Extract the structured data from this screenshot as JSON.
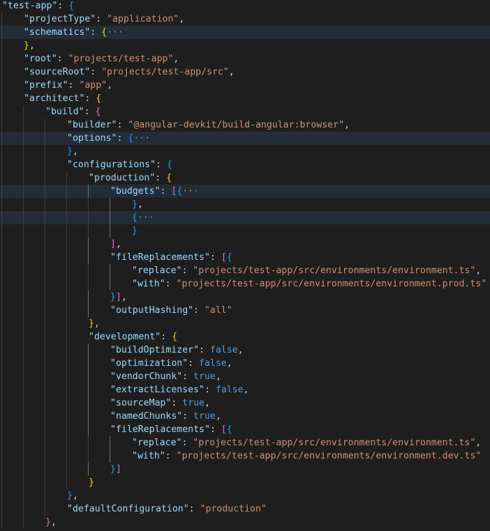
{
  "colors": {
    "background": "#1e1e1e",
    "line_highlight": "#232d38",
    "key": "#9cdcfe",
    "string": "#ce9178",
    "boolean": "#569cd6",
    "punctuation": "#d4d4d4",
    "bracket_gold": "#ffd700",
    "bracket_orchid": "#da70d6",
    "bracket_blue": "#179fff",
    "fold_ellipsis": "#8c8c8c"
  },
  "editor": {
    "lines": [
      {
        "indent": 0,
        "tokens": [
          {
            "t": "key",
            "v": "\"test-app\""
          },
          {
            "t": "p",
            "v": ": "
          },
          {
            "t": "b2",
            "v": "{"
          }
        ]
      },
      {
        "indent": 1,
        "tokens": [
          {
            "t": "key",
            "v": "\"projectType\""
          },
          {
            "t": "p",
            "v": ": "
          },
          {
            "t": "str",
            "v": "\"application\""
          },
          {
            "t": "p",
            "v": ","
          }
        ]
      },
      {
        "indent": 1,
        "highlight": true,
        "tokens": [
          {
            "t": "key",
            "v": "\"schematics\""
          },
          {
            "t": "p",
            "v": ": "
          },
          {
            "t": "b0",
            "v": "{"
          },
          {
            "t": "e",
            "v": "···"
          }
        ]
      },
      {
        "indent": 1,
        "tokens": [
          {
            "t": "b0",
            "v": "}"
          },
          {
            "t": "p",
            "v": ","
          }
        ]
      },
      {
        "indent": 1,
        "tokens": [
          {
            "t": "key",
            "v": "\"root\""
          },
          {
            "t": "p",
            "v": ": "
          },
          {
            "t": "str",
            "v": "\"projects/test-app\""
          },
          {
            "t": "p",
            "v": ","
          }
        ]
      },
      {
        "indent": 1,
        "tokens": [
          {
            "t": "key",
            "v": "\"sourceRoot\""
          },
          {
            "t": "p",
            "v": ": "
          },
          {
            "t": "str",
            "v": "\"projects/test-app/src\""
          },
          {
            "t": "p",
            "v": ","
          }
        ]
      },
      {
        "indent": 1,
        "tokens": [
          {
            "t": "key",
            "v": "\"prefix\""
          },
          {
            "t": "p",
            "v": ": "
          },
          {
            "t": "str",
            "v": "\"app\""
          },
          {
            "t": "p",
            "v": ","
          }
        ]
      },
      {
        "indent": 1,
        "tokens": [
          {
            "t": "key",
            "v": "\"architect\""
          },
          {
            "t": "p",
            "v": ": "
          },
          {
            "t": "b0",
            "v": "{"
          }
        ]
      },
      {
        "indent": 2,
        "tokens": [
          {
            "t": "key",
            "v": "\"build\""
          },
          {
            "t": "p",
            "v": ": "
          },
          {
            "t": "b1",
            "v": "{"
          }
        ]
      },
      {
        "indent": 3,
        "tokens": [
          {
            "t": "key",
            "v": "\"builder\""
          },
          {
            "t": "p",
            "v": ": "
          },
          {
            "t": "str",
            "v": "\"@angular-devkit/build-angular:browser\""
          },
          {
            "t": "p",
            "v": ","
          }
        ]
      },
      {
        "indent": 3,
        "highlight": true,
        "tokens": [
          {
            "t": "key",
            "v": "\"options\""
          },
          {
            "t": "p",
            "v": ": "
          },
          {
            "t": "b2",
            "v": "{"
          },
          {
            "t": "e",
            "v": "···"
          }
        ]
      },
      {
        "indent": 3,
        "tokens": [
          {
            "t": "b2",
            "v": "}"
          },
          {
            "t": "p",
            "v": ","
          }
        ]
      },
      {
        "indent": 3,
        "tokens": [
          {
            "t": "key",
            "v": "\"configurations\""
          },
          {
            "t": "p",
            "v": ": "
          },
          {
            "t": "b2",
            "v": "{"
          }
        ]
      },
      {
        "indent": 4,
        "tokens": [
          {
            "t": "key",
            "v": "\"production\""
          },
          {
            "t": "p",
            "v": ": "
          },
          {
            "t": "b0",
            "v": "{"
          }
        ]
      },
      {
        "indent": 5,
        "highlight": true,
        "tokens": [
          {
            "t": "key",
            "v": "\"budgets\""
          },
          {
            "t": "p",
            "v": ": "
          },
          {
            "t": "b1",
            "v": "["
          },
          {
            "t": "b2",
            "v": "{"
          },
          {
            "t": "e",
            "v": "···"
          }
        ]
      },
      {
        "indent": 6,
        "tokens": [
          {
            "t": "b2",
            "v": "}"
          },
          {
            "t": "p",
            "v": ","
          }
        ]
      },
      {
        "indent": 6,
        "highlight": true,
        "tokens": [
          {
            "t": "b2",
            "v": "{"
          },
          {
            "t": "e",
            "v": "···"
          }
        ]
      },
      {
        "indent": 6,
        "tokens": [
          {
            "t": "b2",
            "v": "}"
          }
        ]
      },
      {
        "indent": 5,
        "tokens": [
          {
            "t": "b1",
            "v": "]"
          },
          {
            "t": "p",
            "v": ","
          }
        ]
      },
      {
        "indent": 5,
        "tokens": [
          {
            "t": "key",
            "v": "\"fileReplacements\""
          },
          {
            "t": "p",
            "v": ": "
          },
          {
            "t": "b1",
            "v": "["
          },
          {
            "t": "b2",
            "v": "{"
          }
        ]
      },
      {
        "indent": 6,
        "tokens": [
          {
            "t": "key",
            "v": "\"replace\""
          },
          {
            "t": "p",
            "v": ": "
          },
          {
            "t": "str",
            "v": "\"projects/test-app/src/environments/environment.ts\""
          },
          {
            "t": "p",
            "v": ","
          }
        ]
      },
      {
        "indent": 6,
        "tokens": [
          {
            "t": "key",
            "v": "\"with\""
          },
          {
            "t": "p",
            "v": ": "
          },
          {
            "t": "str",
            "v": "\"projects/test-app/src/environments/environment.prod.ts\""
          }
        ]
      },
      {
        "indent": 5,
        "tokens": [
          {
            "t": "b2",
            "v": "}"
          },
          {
            "t": "b1",
            "v": "]"
          },
          {
            "t": "p",
            "v": ","
          }
        ]
      },
      {
        "indent": 5,
        "tokens": [
          {
            "t": "key",
            "v": "\"outputHashing\""
          },
          {
            "t": "p",
            "v": ": "
          },
          {
            "t": "str",
            "v": "\"all\""
          }
        ]
      },
      {
        "indent": 4,
        "tokens": [
          {
            "t": "b0",
            "v": "}"
          },
          {
            "t": "p",
            "v": ","
          }
        ]
      },
      {
        "indent": 4,
        "tokens": [
          {
            "t": "key",
            "v": "\"development\""
          },
          {
            "t": "p",
            "v": ": "
          },
          {
            "t": "b0",
            "v": "{"
          }
        ]
      },
      {
        "indent": 5,
        "tokens": [
          {
            "t": "key",
            "v": "\"buildOptimizer\""
          },
          {
            "t": "p",
            "v": ": "
          },
          {
            "t": "kw",
            "v": "false"
          },
          {
            "t": "p",
            "v": ","
          }
        ]
      },
      {
        "indent": 5,
        "tokens": [
          {
            "t": "key",
            "v": "\"optimization\""
          },
          {
            "t": "p",
            "v": ": "
          },
          {
            "t": "kw",
            "v": "false"
          },
          {
            "t": "p",
            "v": ","
          }
        ]
      },
      {
        "indent": 5,
        "tokens": [
          {
            "t": "key",
            "v": "\"vendorChunk\""
          },
          {
            "t": "p",
            "v": ": "
          },
          {
            "t": "kw",
            "v": "true"
          },
          {
            "t": "p",
            "v": ","
          }
        ]
      },
      {
        "indent": 5,
        "tokens": [
          {
            "t": "key",
            "v": "\"extractLicenses\""
          },
          {
            "t": "p",
            "v": ": "
          },
          {
            "t": "kw",
            "v": "false"
          },
          {
            "t": "p",
            "v": ","
          }
        ]
      },
      {
        "indent": 5,
        "tokens": [
          {
            "t": "key",
            "v": "\"sourceMap\""
          },
          {
            "t": "p",
            "v": ": "
          },
          {
            "t": "kw",
            "v": "true"
          },
          {
            "t": "p",
            "v": ","
          }
        ]
      },
      {
        "indent": 5,
        "tokens": [
          {
            "t": "key",
            "v": "\"namedChunks\""
          },
          {
            "t": "p",
            "v": ": "
          },
          {
            "t": "kw",
            "v": "true"
          },
          {
            "t": "p",
            "v": ","
          }
        ]
      },
      {
        "indent": 5,
        "tokens": [
          {
            "t": "key",
            "v": "\"fileReplacements\""
          },
          {
            "t": "p",
            "v": ": "
          },
          {
            "t": "b1",
            "v": "["
          },
          {
            "t": "b2",
            "v": "{"
          }
        ]
      },
      {
        "indent": 6,
        "tokens": [
          {
            "t": "key",
            "v": "\"replace\""
          },
          {
            "t": "p",
            "v": ": "
          },
          {
            "t": "str",
            "v": "\"projects/test-app/src/environments/environment.ts\""
          },
          {
            "t": "p",
            "v": ","
          }
        ]
      },
      {
        "indent": 6,
        "tokens": [
          {
            "t": "key",
            "v": "\"with\""
          },
          {
            "t": "p",
            "v": ": "
          },
          {
            "t": "str",
            "v": "\"projects/test-app/src/environments/environment.dev.ts\""
          }
        ]
      },
      {
        "indent": 5,
        "tokens": [
          {
            "t": "b2",
            "v": "}"
          },
          {
            "t": "b1",
            "v": "]"
          }
        ]
      },
      {
        "indent": 4,
        "tokens": [
          {
            "t": "b0",
            "v": "}"
          }
        ]
      },
      {
        "indent": 3,
        "tokens": [
          {
            "t": "b2",
            "v": "}"
          },
          {
            "t": "p",
            "v": ","
          }
        ]
      },
      {
        "indent": 3,
        "tokens": [
          {
            "t": "key",
            "v": "\"defaultConfiguration\""
          },
          {
            "t": "p",
            "v": ": "
          },
          {
            "t": "str",
            "v": "\"production\""
          }
        ]
      },
      {
        "indent": 2,
        "tokens": [
          {
            "t": "b1",
            "v": "}"
          },
          {
            "t": "p",
            "v": ","
          }
        ]
      }
    ]
  }
}
